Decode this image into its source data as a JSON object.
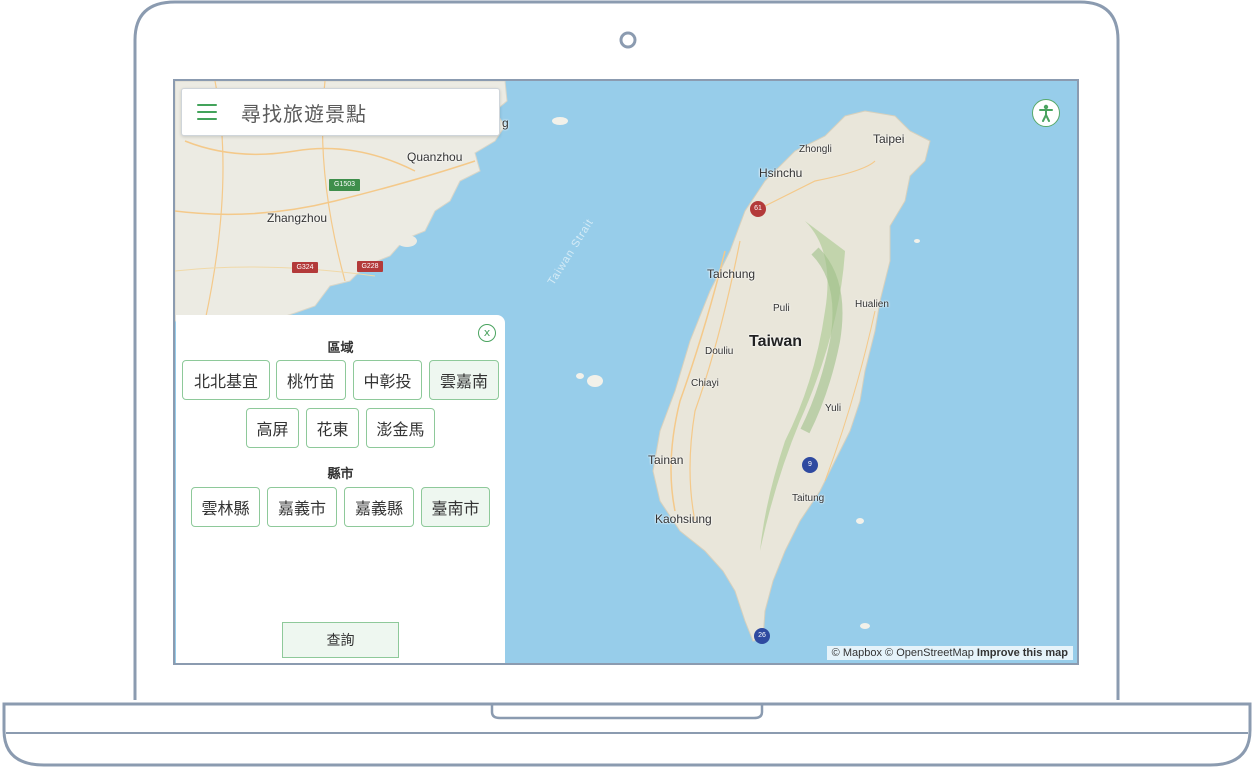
{
  "search": {
    "title": "尋找旅遊景點"
  },
  "map": {
    "labels": {
      "quanzhou": "Quanzhou",
      "zhangzhou": "Zhangzhou",
      "taipei": "Taipei",
      "zhongli": "Zhongli",
      "hsinchu": "Hsinchu",
      "taichung": "Taichung",
      "puli": "Puli",
      "hualien": "Hualien",
      "taiwan": "Taiwan",
      "douliu": "Douliu",
      "chiayi": "Chiayi",
      "yuli": "Yuli",
      "tainan": "Tainan",
      "taitung": "Taitung",
      "kaohsiung": "Kaohsiung",
      "strait": "Taiwan Strait",
      "partial_g": "g"
    },
    "shields": {
      "g1503": "G1503",
      "g324": "G324",
      "g228": "G228",
      "r61": "61",
      "r9": "9",
      "r26": "26"
    },
    "attribution": {
      "mapbox": "© Mapbox",
      "osm": "© OpenStreetMap",
      "improve": "Improve this map"
    }
  },
  "panel": {
    "close_icon": "close-icon",
    "region_label": "區域",
    "regions": [
      "北北基宜",
      "桃竹苗",
      "中彰投",
      "雲嘉南",
      "高屏",
      "花東",
      "澎金馬"
    ],
    "active_region": "雲嘉南",
    "county_label": "縣市",
    "counties": [
      "雲林縣",
      "嘉義市",
      "嘉義縣",
      "臺南市"
    ],
    "active_county": "臺南市",
    "query_label": "查詢"
  }
}
